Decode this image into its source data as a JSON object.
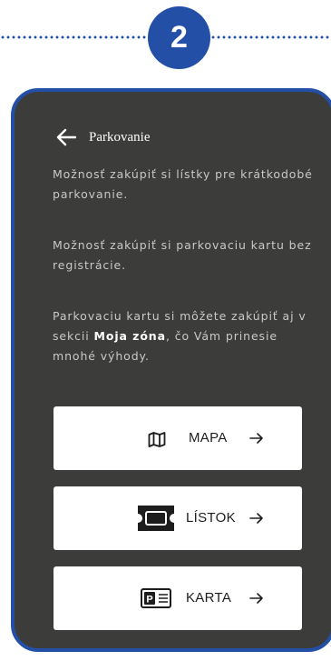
{
  "step": {
    "number": "2"
  },
  "header": {
    "title": "Parkovanie",
    "icon": "arrow-left-icon"
  },
  "paragraphs": {
    "p1": "Možnosť zakúpiť si lístky pre krátkodobé parkovanie.",
    "p2": "Možnosť zakúpiť si parkovaciu kartu bez registrácie.",
    "p3_before": "Parkovaciu kartu si môžete zakúpiť aj v sekcii ",
    "p3_bold": "Moja zóna",
    "p3_after": ", čo Vám prinesie mnohé výhody."
  },
  "buttons": [
    {
      "label": "MAPA",
      "icon": "map-icon"
    },
    {
      "label": "LÍSTOK",
      "icon": "ticket-icon"
    },
    {
      "label": "KARTA",
      "icon": "parking-card-icon"
    }
  ],
  "colors": {
    "accent": "#2350a6",
    "card_background": "#3c3c3b",
    "button_background": "#ffffff"
  }
}
